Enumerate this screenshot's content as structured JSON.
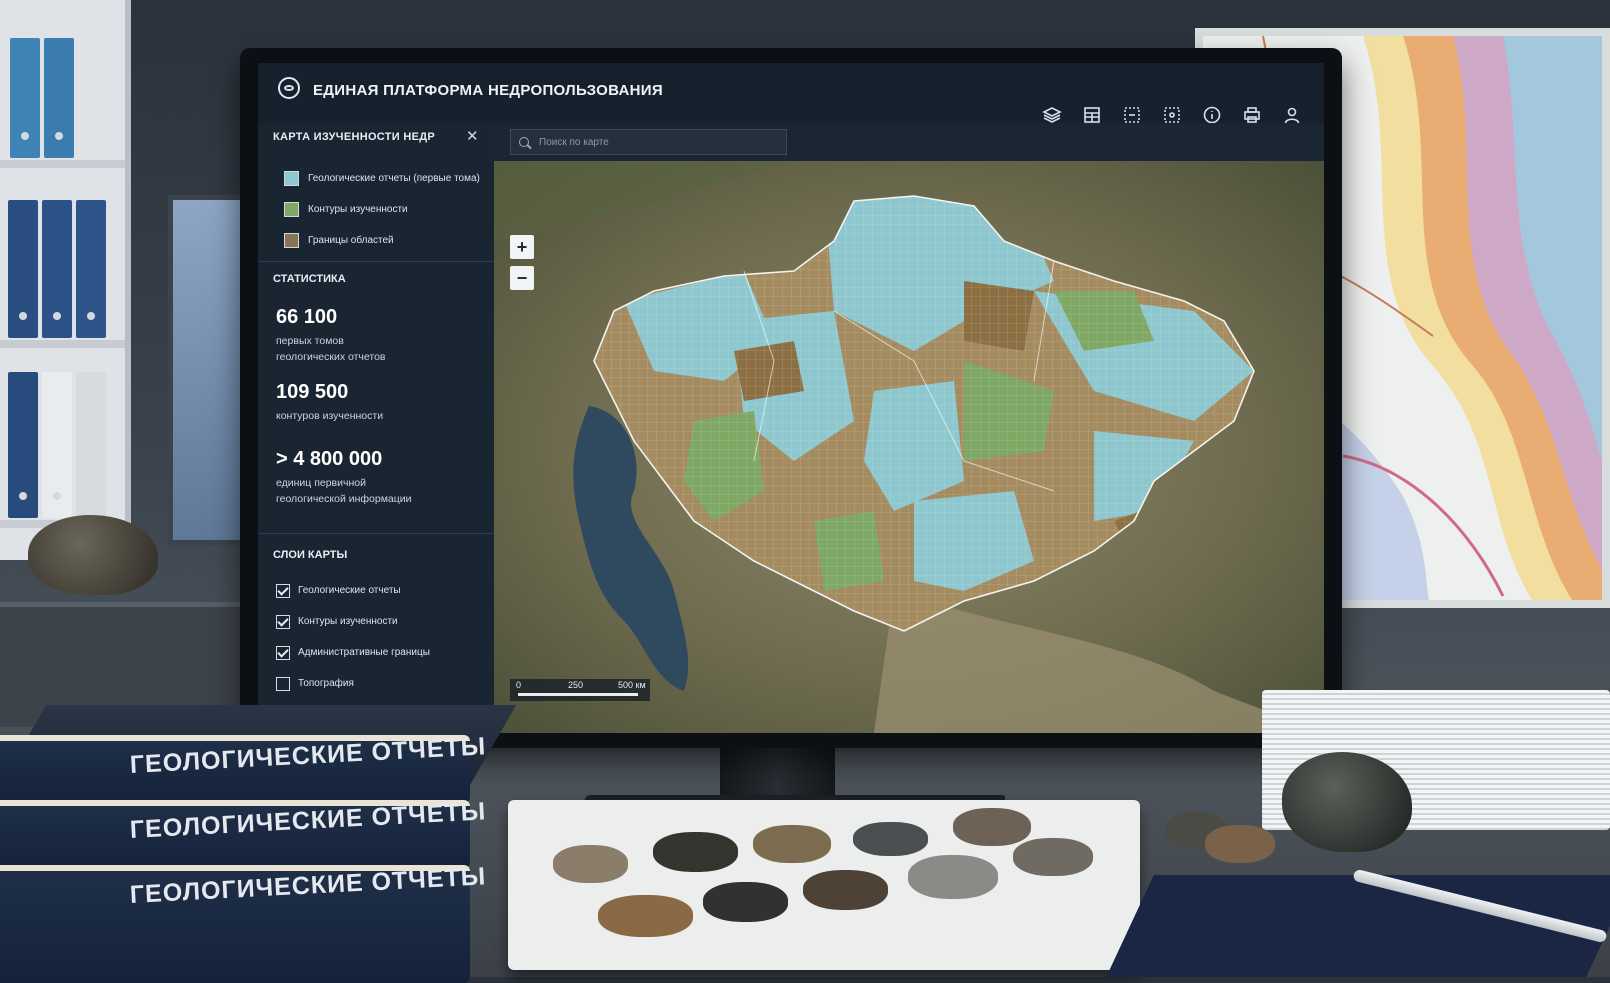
{
  "app": {
    "title": "ЕДИНАЯ ПЛАТФОРМА НЕДРОПОЛЬЗОВАНИЯ"
  },
  "toolbar": {
    "icons": [
      "layers-icon",
      "table-icon",
      "select-area-icon",
      "measure-icon",
      "info-icon",
      "print-icon",
      "user-icon"
    ]
  },
  "sidebar": {
    "panel_title": "КАРТА ИЗУЧЕННОСТИ НЕДР",
    "legend": [
      {
        "label": "Геологические отчеты (первые тома)",
        "color": "#8fc7cf"
      },
      {
        "label": "Контуры изученности",
        "color": "#7fa865"
      },
      {
        "label": "Границы областей",
        "color": "#8a7358"
      }
    ],
    "stats_title": "СТАТИСТИКА",
    "stats": [
      {
        "value": "66 100",
        "label": "первых томов геологических отчетов"
      },
      {
        "value": "109 500",
        "label": "контуров изученности"
      },
      {
        "value": "> 4 800 000",
        "label": "единиц первичной геологической информации"
      }
    ],
    "layers_title": "СЛОИ КАРТЫ",
    "layers": [
      {
        "label": "Геологические отчеты",
        "checked": true
      },
      {
        "label": "Контуры изученности",
        "checked": true
      },
      {
        "label": "Административные границы",
        "checked": true
      },
      {
        "label": "Топография",
        "checked": false
      }
    ]
  },
  "map": {
    "search_placeholder": "Поиск по карте",
    "zoom_in": "+",
    "zoom_out": "−",
    "scale": {
      "start": "0",
      "mid": "250",
      "end": "500 км"
    }
  },
  "desk": {
    "book_titles": [
      "ГЕОЛОГИЧЕСКИЕ ОТЧЕТЫ",
      "ГЕОЛОГИЧЕСКИЕ ОТЧЕТЫ",
      "ГЕОЛОГИЧЕСКИЕ ОТЧЕТЫ"
    ]
  },
  "colors": {
    "accent_blue": "#8fc7cf",
    "accent_green": "#7fa865",
    "accent_brown": "#8a7358",
    "panel_bg": "#1a2532"
  }
}
